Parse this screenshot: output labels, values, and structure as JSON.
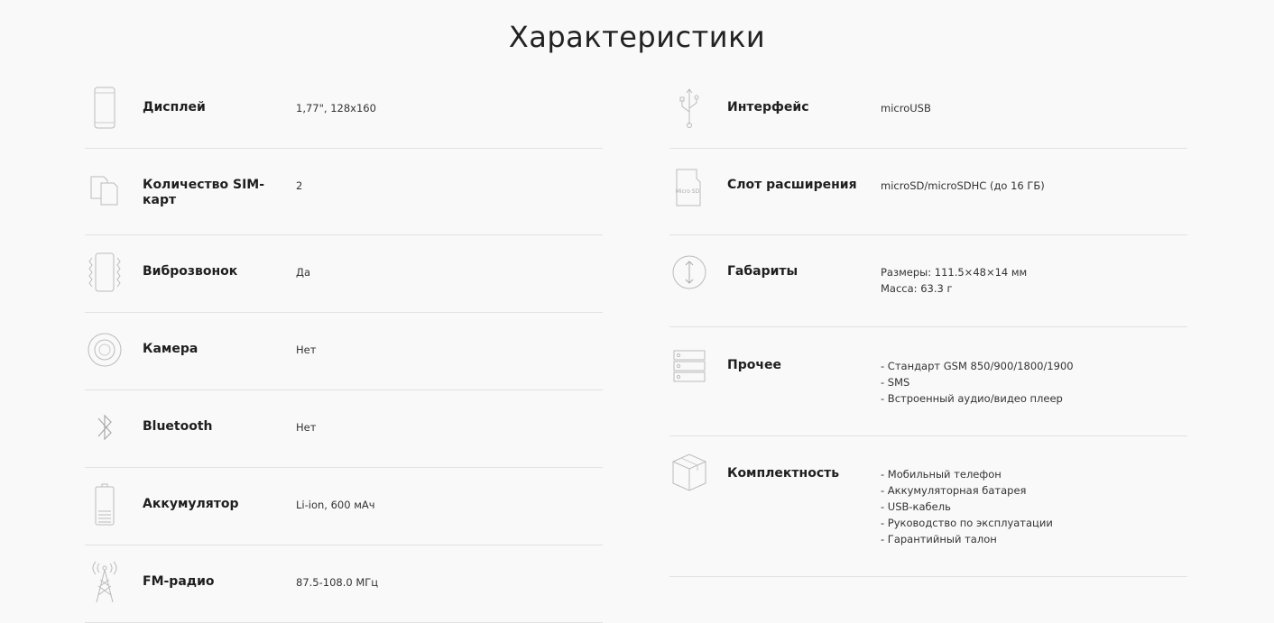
{
  "title": "Характеристики",
  "left": [
    {
      "icon": "phone-display-icon",
      "label": "Дисплей",
      "value": [
        "1,77\", 128x160"
      ]
    },
    {
      "icon": "sim-cards-icon",
      "label": "Количество SIM-карт",
      "value": [
        "2"
      ]
    },
    {
      "icon": "vibration-icon",
      "label": "Виброзвонок",
      "value": [
        "Да"
      ]
    },
    {
      "icon": "camera-icon",
      "label": "Камера",
      "value": [
        "Нет"
      ]
    },
    {
      "icon": "bluetooth-icon",
      "label": "Bluetooth",
      "value": [
        "Нет"
      ]
    },
    {
      "icon": "battery-icon",
      "label": "Аккумулятор",
      "value": [
        "Li-ion, 600 мАч"
      ]
    },
    {
      "icon": "radio-tower-icon",
      "label": "FM-радио",
      "value": [
        "87.5-108.0 МГц"
      ]
    }
  ],
  "right": [
    {
      "icon": "usb-icon",
      "label": "Интерфейс",
      "value": [
        "microUSB"
      ]
    },
    {
      "icon": "micro-sd-icon",
      "icon_text": "Micro SD",
      "label": "Слот расширения",
      "value": [
        "microSD/microSDHC (до 16 ГБ)"
      ]
    },
    {
      "icon": "dimensions-icon",
      "label": "Габариты",
      "value": [
        "Размеры: 111.5×48×14 мм",
        "Масса: 63.3 г"
      ]
    },
    {
      "icon": "other-list-icon",
      "label": "Прочее",
      "value": [
        "- Стандарт GSM 850/900/1800/1900",
        "- SMS",
        "- Встроенный аудио/видео плеер"
      ]
    },
    {
      "icon": "package-box-icon",
      "label": "Комплектность",
      "value": [
        "- Мобильный телефон",
        "- Аккумуляторная батарея",
        "- USB-кабель",
        "- Руководство по эксплуатации",
        "- Гарантийный талон"
      ]
    }
  ]
}
